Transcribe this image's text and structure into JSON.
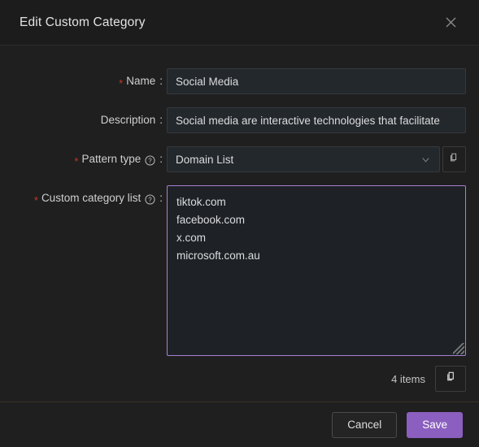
{
  "dialog": {
    "title": "Edit Custom Category",
    "close_icon": "close-icon"
  },
  "form": {
    "name": {
      "label": "Name",
      "required_marker": "*",
      "colon": ":",
      "value": "Social Media",
      "placeholder": ""
    },
    "description": {
      "label": "Description",
      "colon": ":",
      "value": "Social media are interactive technologies that facilitate",
      "placeholder": ""
    },
    "pattern_type": {
      "label": "Pattern type",
      "required_marker": "*",
      "colon": ":",
      "help_icon": "help-circle-icon",
      "value": "Domain List",
      "chevron_icon": "chevron-down-icon",
      "copy_icon": "copy-icon"
    },
    "custom_category_list": {
      "label": "Custom category list",
      "required_marker": "*",
      "colon": ":",
      "help_icon": "help-circle-icon",
      "entries": [
        "tiktok.com",
        "facebook.com",
        "x.com",
        "microsoft.com.au"
      ],
      "items_count_label": "4 items",
      "copy_icon": "copy-icon"
    }
  },
  "footer": {
    "cancel_label": "Cancel",
    "save_label": "Save"
  },
  "colors": {
    "accent": "#8b5fbf",
    "focus_border": "#a97fd4",
    "required": "#c0392b",
    "dialog_bg": "#1f1f1f",
    "header_bg": "#1c1c1c",
    "input_bg": "#23282d"
  }
}
